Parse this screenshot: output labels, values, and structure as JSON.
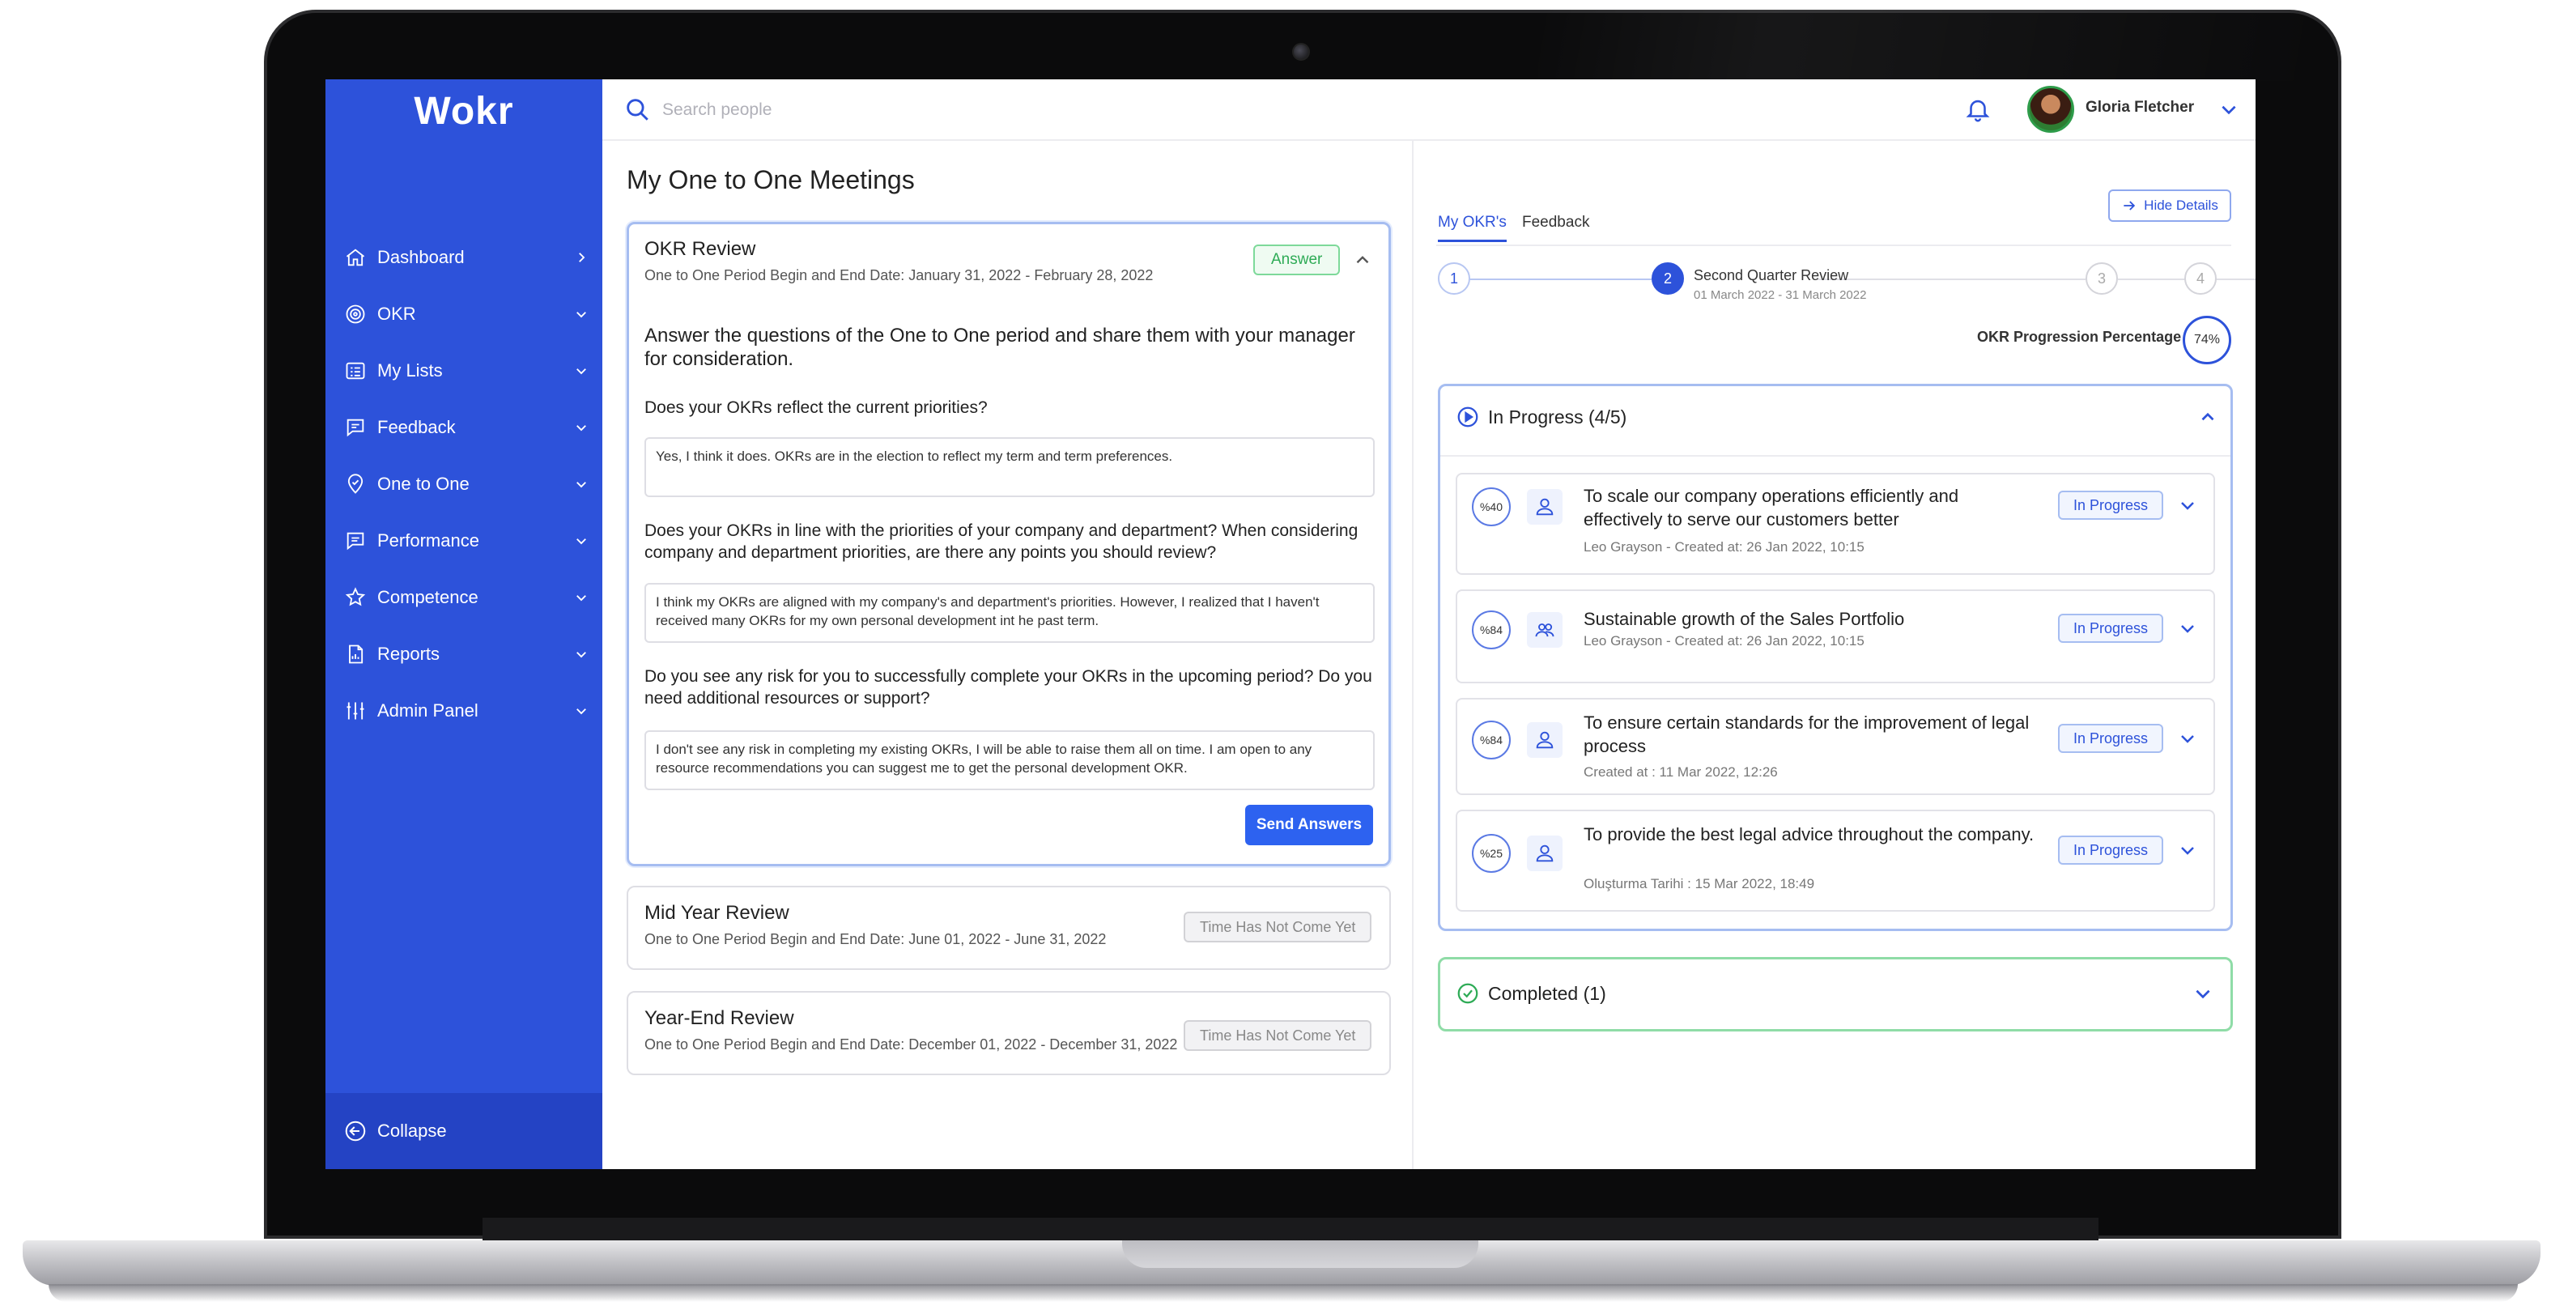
{
  "app": {
    "logo": "Wokr"
  },
  "sidebar": {
    "items": [
      {
        "label": "Dashboard",
        "icon": "home-icon",
        "chevron": "chevron-right-icon"
      },
      {
        "label": "OKR",
        "icon": "target-icon",
        "chevron": "chevron-down-icon"
      },
      {
        "label": "My Lists",
        "icon": "list-icon",
        "chevron": "chevron-down-icon"
      },
      {
        "label": "Feedback",
        "icon": "message-icon",
        "chevron": "chevron-down-icon"
      },
      {
        "label": "One to One",
        "icon": "location-pin-icon",
        "chevron": "chevron-down-icon"
      },
      {
        "label": "Performance",
        "icon": "chart-message-icon",
        "chevron": "chevron-down-icon"
      },
      {
        "label": "Competence",
        "icon": "star-icon",
        "chevron": "chevron-down-icon"
      },
      {
        "label": "Reports",
        "icon": "report-icon",
        "chevron": "chevron-down-icon"
      },
      {
        "label": "Admin Panel",
        "icon": "sliders-icon",
        "chevron": "chevron-down-icon"
      }
    ],
    "collapse_label": "Collapse"
  },
  "topbar": {
    "search_placeholder": "Search people",
    "user_name": "Gloria Fletcher"
  },
  "main": {
    "title": "My One to One Meetings",
    "meetings": [
      {
        "title": "OKR Review",
        "period": "One to One Period Begin and End Date: January 31, 2022 - February 28, 2022",
        "status": "Answer",
        "intro": "Answer the questions of the One to One period and share them with your manager for consideration.",
        "questions": [
          {
            "q": "Does your OKRs reflect the current priorities?",
            "a": "Yes, I think it does. OKRs are in the election to reflect my term and term preferences."
          },
          {
            "q": "Does your OKRs in line with the priorities of your company and department? When considering company and department priorities, are there any points you should review?",
            "a": "I think my OKRs are aligned with my company's and department's priorities. However, I realized that I haven't received many OKRs for my own personal development int he past term."
          },
          {
            "q": "Do you see any risk for you to successfully complete your OKRs in the upcoming period? Do you need additional resources or support?",
            "a": "I don't see any risk in completing my existing OKRs, I will be able to raise them all on time. I am open to any resource recommendations you can suggest me to get the personal development OKR."
          }
        ],
        "send_label": "Send Answers"
      },
      {
        "title": "Mid Year Review",
        "period": "One to One Period Begin and End Date: June 01, 2022 - June 31, 2022",
        "status": "Time Has Not Come Yet"
      },
      {
        "title": "Year-End Review",
        "period": "One to One Period Begin and End Date: December 01, 2022 - December 31, 2022",
        "status": "Time Has Not Come Yet"
      }
    ]
  },
  "details": {
    "tabs": [
      "My OKR's",
      "Feedback"
    ],
    "hide_label": "Hide Details",
    "steps": [
      {
        "num": "1"
      },
      {
        "num": "2",
        "title": "Second Quarter Review",
        "date": "01 March 2022 - 31 March 2022"
      },
      {
        "num": "3"
      },
      {
        "num": "4"
      }
    ],
    "progress_label": "OKR Progression Percentage",
    "progress_value": "74%",
    "in_progress": {
      "title": "In Progress (4/5)",
      "items": [
        {
          "pct": "%40",
          "icon": "user-icon",
          "title": "To scale our company operations efficiently and effectively to serve our customers better",
          "meta": "Leo Grayson  - Created at: 26 Jan 2022, 10:15",
          "status": "In Progress"
        },
        {
          "pct": "%84",
          "icon": "group-icon",
          "title": "Sustainable growth of the Sales Portfolio",
          "meta": "Leo Grayson  - Created at: 26 Jan 2022, 10:15",
          "status": "In Progress"
        },
        {
          "pct": "%84",
          "icon": "user-icon",
          "title": "To ensure certain standards for the improvement of legal process",
          "meta": "Created at : 11 Mar 2022, 12:26",
          "status": "In Progress"
        },
        {
          "pct": "%25",
          "icon": "user-icon",
          "title": "To provide the best legal advice throughout the company.",
          "meta": "Oluşturma Tarihi : 15 Mar 2022, 18:49",
          "status": "In Progress"
        }
      ]
    },
    "completed": {
      "title": "Completed (1)"
    }
  },
  "colors": {
    "brand": "#2d52da",
    "success": "#2eab56",
    "border": "#dedee4"
  }
}
